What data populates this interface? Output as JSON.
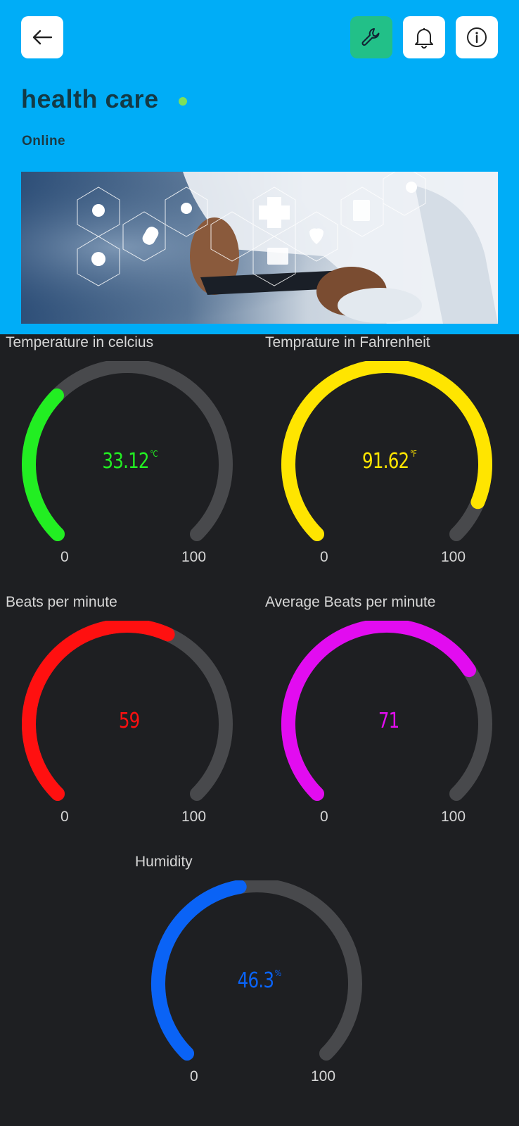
{
  "header": {
    "title": "health care",
    "status": "Online",
    "status_color": "#7ee05a",
    "background": "#00adf7",
    "icons": {
      "back": "arrow-left-icon",
      "settings": "wrench-icon",
      "notifications": "bell-icon",
      "info": "info-icon"
    }
  },
  "gauges": [
    {
      "label": "Temperature in celcius",
      "value": "33.12",
      "unit": "°C",
      "value_number": 33.12,
      "min": "0",
      "max": "100",
      "color": "#22ee22"
    },
    {
      "label": "Temprature in Fahrenheit",
      "value": "91.62",
      "unit": "°F",
      "value_number": 91.62,
      "min": "0",
      "max": "100",
      "color": "#ffe500"
    },
    {
      "label": "Beats per minute",
      "value": "59",
      "unit": "",
      "value_number": 59,
      "min": "0",
      "max": "100",
      "color": "#ff1010"
    },
    {
      "label": "Average Beats per minute",
      "value": "71",
      "unit": "",
      "value_number": 71,
      "min": "0",
      "max": "100",
      "color": "#e20cf0"
    },
    {
      "label": "Humidity",
      "value": "46.3",
      "unit": "%",
      "value_number": 46.3,
      "min": "0",
      "max": "100",
      "color": "#0a63f6"
    }
  ]
}
